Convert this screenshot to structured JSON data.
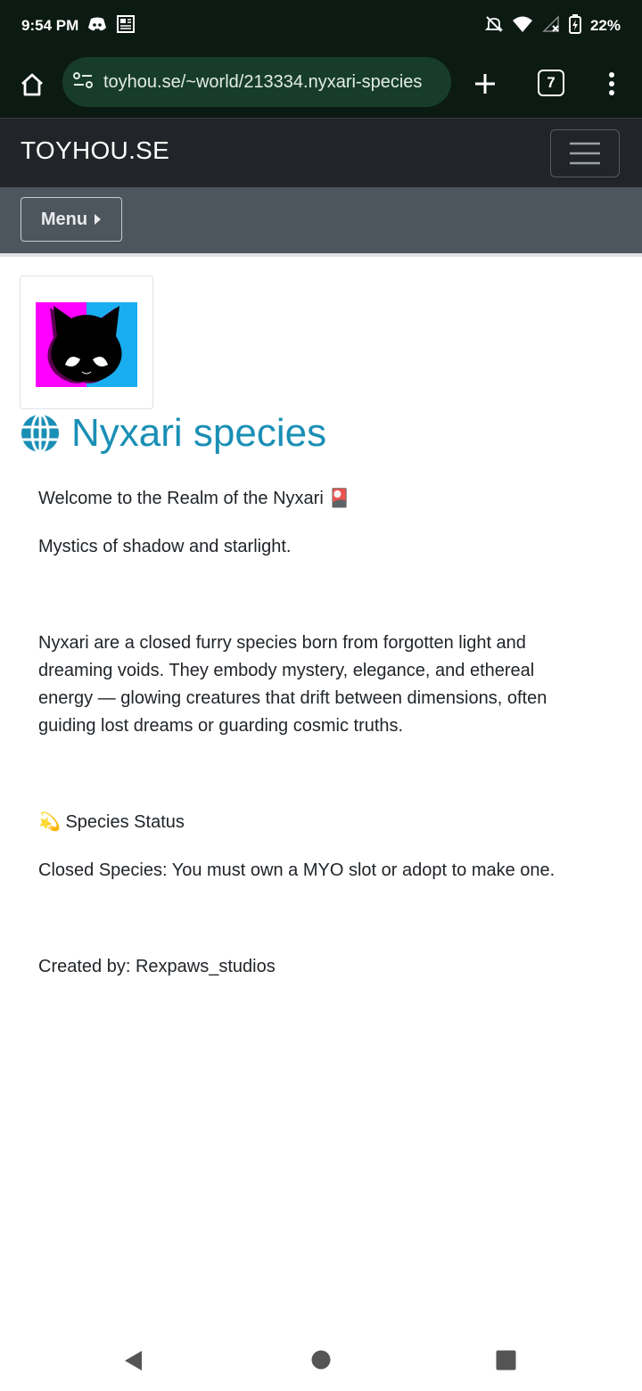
{
  "status_bar": {
    "time": "9:54 PM",
    "battery_percent": "22%",
    "icons": [
      "discord-icon",
      "news-icon",
      "mute-icon",
      "wifi-icon",
      "signal-icon",
      "battery-icon"
    ]
  },
  "browser": {
    "url": "toyhou.se/~world/213334.nyxari-species",
    "tab_count": "7"
  },
  "site": {
    "brand": "TOYHOU.SE",
    "menu_label": "Menu"
  },
  "world": {
    "title": "Nyxari species",
    "paragraphs": {
      "welcome": "Welcome to the Realm of the Nyxari 🎴",
      "tagline": "Mystics of shadow and starlight.",
      "description": "Nyxari are a closed furry species born from forgotten light and dreaming voids. They embody mystery, elegance, and ethereal energy — glowing creatures that drift between dimensions, often guiding lost dreams or guarding cosmic truths.",
      "status_heading": "💫 Species Status",
      "status_text": "Closed Species: You must own a MYO slot or adopt to make one.",
      "credit": "Created by: Rexpaws_studios"
    }
  },
  "colors": {
    "status_bg": "#0b1a12",
    "url_bar_bg": "#173d2a",
    "navbar_bg": "#212529",
    "subnav_bg": "#4d555d",
    "title_link": "#1a8fb5"
  }
}
